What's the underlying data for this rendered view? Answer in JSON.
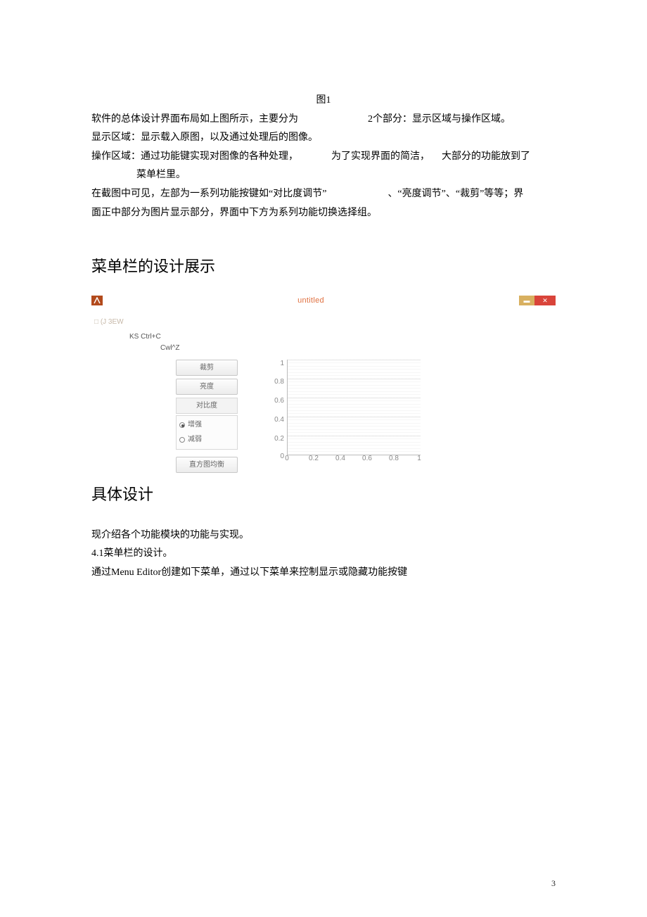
{
  "caption_fig1": "图1",
  "p1a": "软件的总体设计界面布局如上图所示，主要分为",
  "p1b": "2个部分：显示区域与操作区域。",
  "p2": "显示区域：显示载入原图，以及通过处理后的图像。",
  "p3a": "操作区域：通过功能键实现对图像的各种处理，",
  "p3b": "为了实现界面的简洁，",
  "p3c": "大部分的功能放到了",
  "p3d": "菜单栏里。",
  "p4a": "在截图中可见，左部为一系列功能按键如“对比度调节”",
  "p4b": "、“亮度调节”、“裁剪”等等；界",
  "p4c": "面正中部分为图片显示部分，界面中下方为系列功能切换选择组。",
  "h_menu": "菜单栏的设计展示",
  "app": {
    "title": "untitled",
    "menu_root": "□ (J 3EW",
    "menu_ks": "KS Ctrl+C",
    "menu_cwl": "Cwl^Z",
    "btn_crop": "裁剪",
    "btn_bright": "亮度",
    "group_contrast": "对比度",
    "radio_inc": "增强",
    "radio_dec": "减弱",
    "btn_hist": "直方图均衡",
    "winmin_glyph": "▬",
    "winclose_glyph": "✕"
  },
  "chart_data": {
    "type": "line",
    "title": "",
    "xlabel": "",
    "ylabel": "",
    "xlim": [
      0,
      1
    ],
    "ylim": [
      0,
      1
    ],
    "xticks": [
      0,
      0.2,
      0.4,
      0.6,
      0.8,
      1
    ],
    "yticks": [
      0,
      0.2,
      0.4,
      0.6,
      0.8,
      1
    ],
    "series": []
  },
  "h_detail": "具体设计",
  "d1": "现介绍各个功能模块的功能与实现。",
  "d2": "4.1菜单栏的设计。",
  "d3": "通过Menu Editor创建如下菜单，通过以下菜单来控制显示或隐藏功能按键",
  "page_number": "3"
}
